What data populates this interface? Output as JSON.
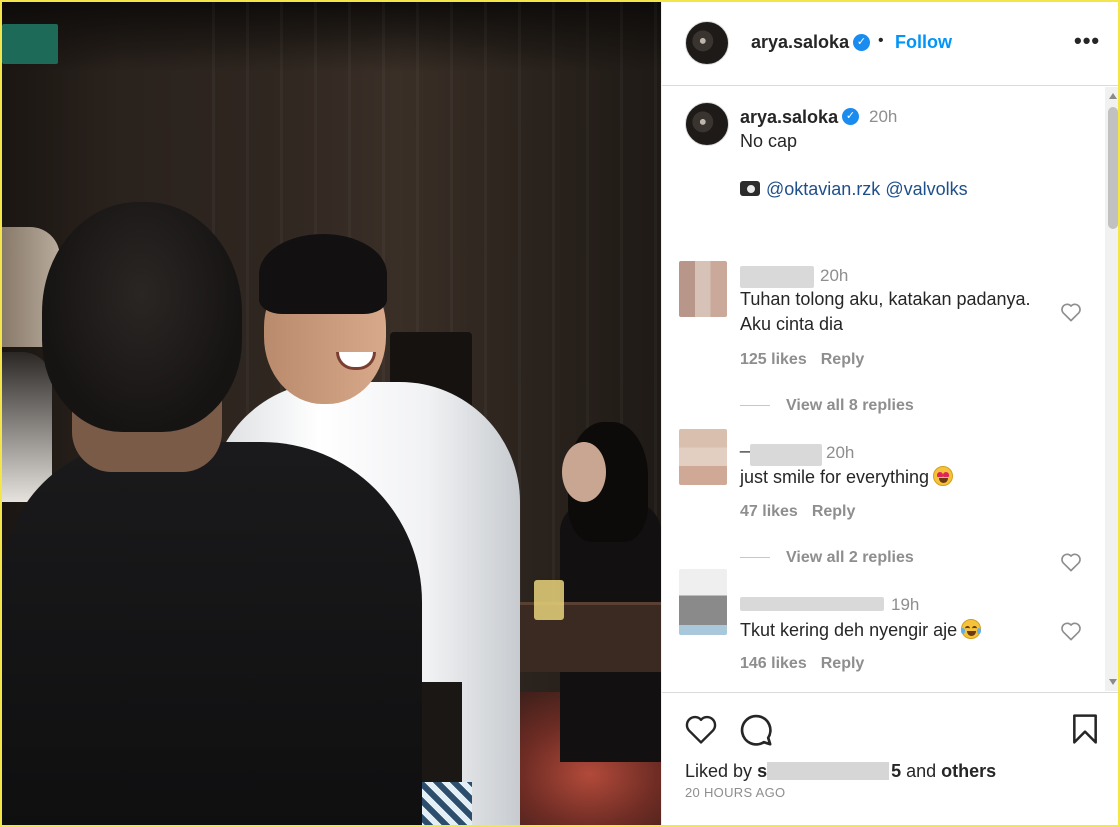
{
  "post": {
    "author": "arya.saloka",
    "follow_label": "Follow",
    "separator": "•",
    "more_label": "•••"
  },
  "caption": {
    "author": "arya.saloka",
    "time": "20h",
    "text": "No cap",
    "mention_1": "@oktavian.rzk",
    "mention_2": "@valvolks"
  },
  "comments": [
    {
      "time": "20h",
      "text": "Tuhan tolong aku, katakan padanya. Aku cinta dia",
      "likes": "125 likes",
      "reply_label": "Reply",
      "view_replies": "View all 8 replies"
    },
    {
      "name_visible_prefix": "_",
      "time": "20h",
      "text": "just smile for everything",
      "emoji": "heart-eyes",
      "likes": "47 likes",
      "reply_label": "Reply",
      "view_replies": "View all 2 replies"
    },
    {
      "time": "19h",
      "text": "Tkut kering deh nyengir aje",
      "emoji": "tears-of-joy",
      "likes": "146 likes",
      "reply_label": "Reply"
    }
  ],
  "footer": {
    "liked_by_prefix": "Liked by",
    "liked_by_visible_start": "s",
    "liked_by_visible_end": "5",
    "and_label": "and",
    "others_label": "others",
    "post_time": "20 HOURS AGO"
  },
  "colors": {
    "link_blue": "#0095f6",
    "mention_blue": "#1f4f8a",
    "verified_blue": "#1a8cf0",
    "muted_gray": "#8e8e8e",
    "frame_yellow": "#f2e64a"
  },
  "icons": [
    "verified-icon",
    "more-icon",
    "camera-icon",
    "heart-icon",
    "comment-icon",
    "bookmark-icon"
  ]
}
